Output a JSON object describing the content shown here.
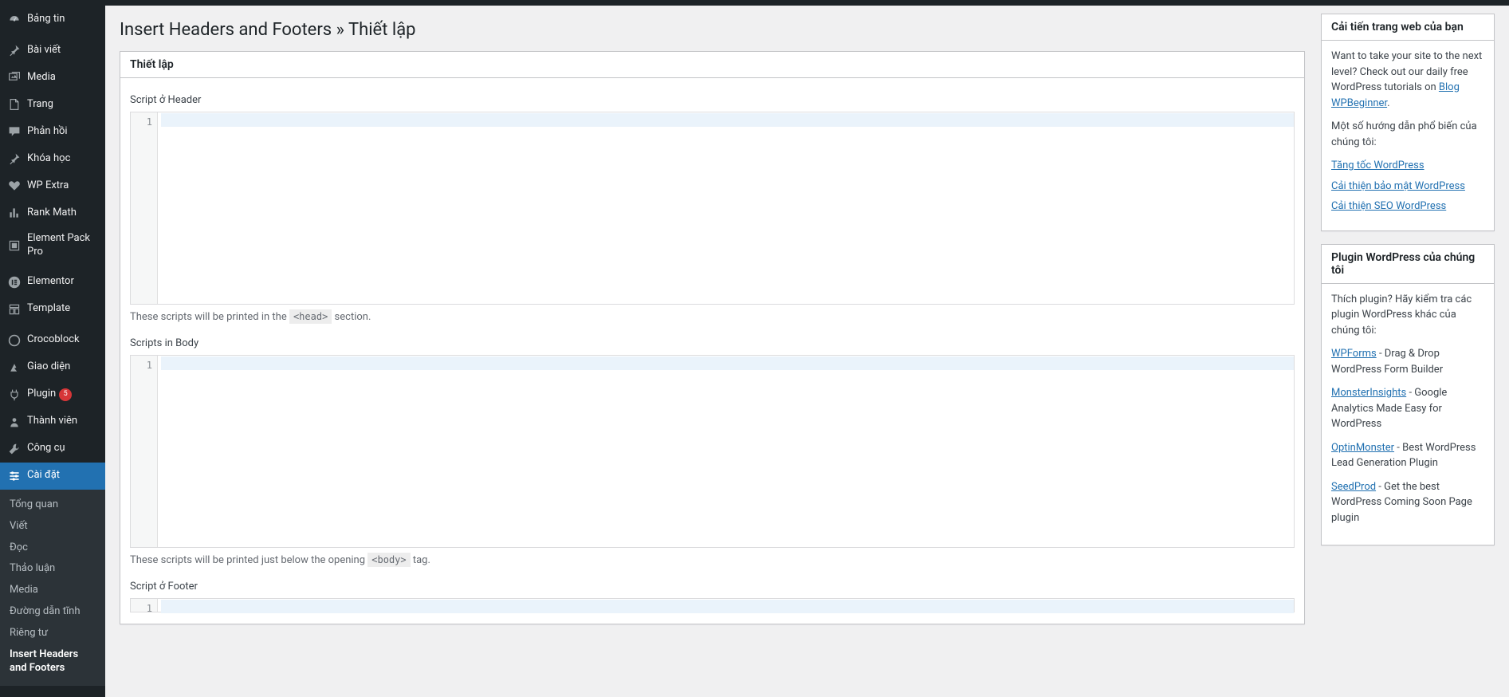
{
  "page_title": "Insert Headers and Footers » Thiết lập",
  "sidebar": {
    "items": [
      {
        "icon": "dashboard",
        "label": "Bảng tin"
      },
      {
        "sep": true
      },
      {
        "icon": "pin",
        "label": "Bài viết"
      },
      {
        "icon": "media",
        "label": "Media"
      },
      {
        "icon": "page",
        "label": "Trang"
      },
      {
        "icon": "comment",
        "label": "Phản hồi"
      },
      {
        "icon": "pin",
        "label": "Khóa học"
      },
      {
        "icon": "heart",
        "label": "WP Extra"
      },
      {
        "icon": "chart",
        "label": "Rank Math"
      },
      {
        "icon": "pack",
        "label": "Element Pack Pro"
      },
      {
        "sep": true
      },
      {
        "icon": "elementor",
        "label": "Elementor"
      },
      {
        "icon": "template",
        "label": "Template"
      },
      {
        "sep": true
      },
      {
        "icon": "croco",
        "label": "Crocoblock"
      },
      {
        "icon": "appearance",
        "label": "Giao diện"
      },
      {
        "icon": "plugin",
        "label": "Plugin",
        "badge": "5"
      },
      {
        "icon": "users",
        "label": "Thành viên"
      },
      {
        "icon": "tools",
        "label": "Công cụ"
      },
      {
        "icon": "settings",
        "label": "Cài đặt",
        "active": true
      }
    ],
    "submenu": [
      {
        "label": "Tổng quan"
      },
      {
        "label": "Viết"
      },
      {
        "label": "Đọc"
      },
      {
        "label": "Thảo luận"
      },
      {
        "label": "Media"
      },
      {
        "label": "Đường dẫn tĩnh"
      },
      {
        "label": "Riêng tư"
      },
      {
        "label": "Insert Headers and Footers",
        "current": true
      }
    ]
  },
  "settings": {
    "box_title": "Thiết lập",
    "fields": [
      {
        "label": "Script ở Header",
        "line": "1",
        "desc_pre": "These scripts will be printed in the ",
        "tag": "<head>",
        "desc_post": " section."
      },
      {
        "label": "Scripts in Body",
        "line": "1",
        "desc_pre": "These scripts will be printed just below the opening ",
        "tag": "<body>",
        "desc_post": " tag."
      },
      {
        "label": "Script ở Footer",
        "line": "1"
      }
    ]
  },
  "aside": {
    "improve": {
      "title": "Cải tiến trang web của bạn",
      "p1a": "Want to take your site to the next level? Check out our daily free WordPress tutorials on ",
      "p1link": "Blog WPBeginner",
      "p2": "Một số hướng dẫn phổ biến của chúng tôi:",
      "links": [
        "Tăng tốc WordPress",
        "Cải thiện bảo mật WordPress",
        "Cải thiện SEO WordPress"
      ]
    },
    "plugins": {
      "title": "Plugin WordPress của chúng tôi",
      "intro": "Thích plugin? Hãy kiểm tra các plugin WordPress khác của chúng tôi:",
      "items": [
        {
          "name": "WPForms",
          "desc": " - Drag & Drop WordPress Form Builder"
        },
        {
          "name": "MonsterInsights",
          "desc": " - Google Analytics Made Easy for WordPress"
        },
        {
          "name": "OptinMonster",
          "desc": " - Best WordPress Lead Generation Plugin"
        },
        {
          "name": "SeedProd",
          "desc": " - Get the best WordPress Coming Soon Page plugin"
        }
      ]
    }
  }
}
